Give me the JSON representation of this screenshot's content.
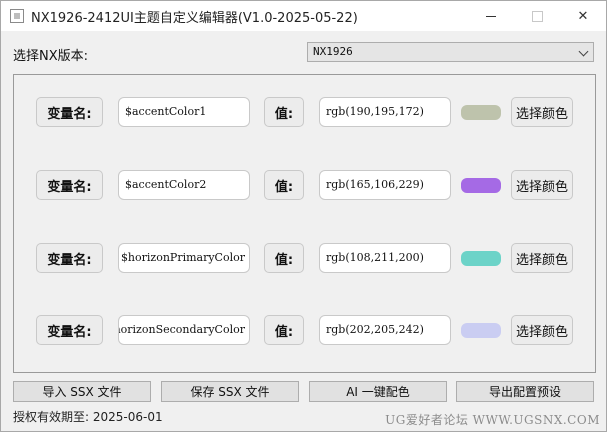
{
  "window": {
    "title": "NX1926-2412UI主题自定义编辑器(V1.0-2025-05-22)",
    "icon": "app-icon"
  },
  "version": {
    "label": "选择NX版本:",
    "selected": "NX1926"
  },
  "rows": [
    {
      "var_label": "变量名:",
      "var_value": "$accentColor1",
      "value_label": "值:",
      "color_value": "rgb(190,195,172)",
      "swatch": "#bec3ac",
      "pick_label": "选择颜色"
    },
    {
      "var_label": "变量名:",
      "var_value": "$accentColor2",
      "value_label": "值:",
      "color_value": "rgb(165,106,229)",
      "swatch": "#a56ae5",
      "pick_label": "选择颜色"
    },
    {
      "var_label": "变量名:",
      "var_value": "$horizonPrimaryColor",
      "value_label": "值:",
      "color_value": "rgb(108,211,200)",
      "swatch": "#6cd3c8",
      "pick_label": "选择颜色"
    },
    {
      "var_label": "变量名:",
      "var_value": "$horizonSecondaryColor",
      "value_label": "值:",
      "color_value": "rgb(202,205,242)",
      "swatch": "#cacdf2",
      "pick_label": "选择颜色"
    }
  ],
  "actions": {
    "import": "导入 SSX 文件",
    "save": "保存 SSX 文件",
    "ai": "AI 一键配色",
    "export": "导出配置预设"
  },
  "footer": {
    "license": "授权有效期至: 2025-06-01",
    "watermark": "UG爱好者论坛 WWW.UGSNX.COM"
  }
}
